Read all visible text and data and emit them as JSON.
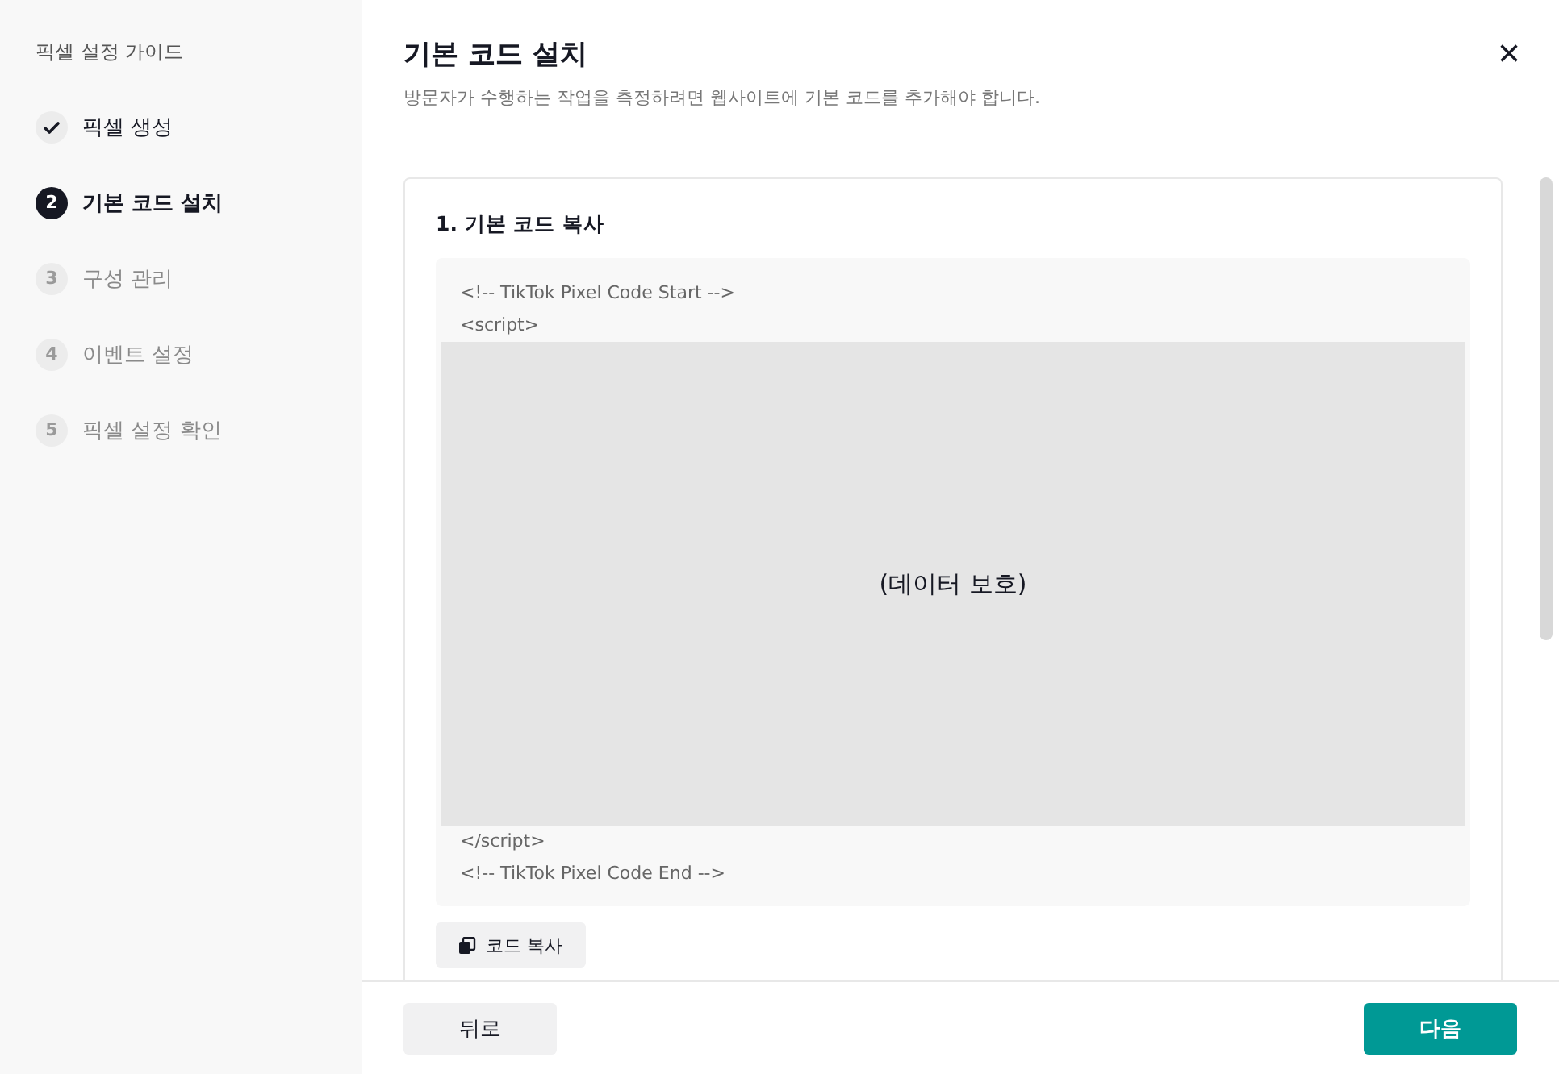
{
  "sidebar": {
    "title": "픽셀 설정 가이드",
    "steps": [
      {
        "kind": "done",
        "label": "픽셀 생성"
      },
      {
        "kind": "current",
        "number": "2",
        "label": "기본 코드 설치"
      },
      {
        "kind": "pending",
        "number": "3",
        "label": "구성 관리"
      },
      {
        "kind": "pending",
        "number": "4",
        "label": "이벤트 설정"
      },
      {
        "kind": "pending",
        "number": "5",
        "label": "픽셀 설정 확인"
      }
    ]
  },
  "header": {
    "title": "기본 코드 설치",
    "subtitle": "방문자가 수행하는 작업을 측정하려면 웹사이트에 기본 코드를 추가해야 합니다.",
    "close": "×"
  },
  "section": {
    "title": "1. 기본 코드 복사",
    "code_top": [
      "<!-- TikTok Pixel Code Start -->",
      "<script>"
    ],
    "masked": "(데이터 보호)",
    "code_bottom": [
      "</script>",
      "<!-- TikTok Pixel Code End -->"
    ],
    "copy_button": "코드 복사"
  },
  "footer": {
    "back": "뒤로",
    "next": "다음"
  }
}
